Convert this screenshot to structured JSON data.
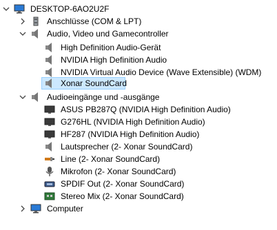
{
  "tree": {
    "root": {
      "label": "DESKTOP-6AO2U2F"
    },
    "ports": {
      "label": "Anschlüsse (COM & LPT)"
    },
    "audio_group": {
      "label": "Audio, Video und Gamecontroller",
      "items": [
        "High Definition Audio-Gerät",
        "NVIDIA High Definition Audio",
        "NVIDIA Virtual Audio Device (Wave Extensible) (WDM)",
        "Xonar SoundCard"
      ]
    },
    "io_group": {
      "label": "Audioeingänge und -ausgänge",
      "items": [
        "ASUS PB287Q (NVIDIA High Definition Audio)",
        "G276HL (NVIDIA High Definition Audio)",
        "HF287 (NVIDIA High Definition Audio)",
        "Lautsprecher (2- Xonar SoundCard)",
        "Line (2- Xonar SoundCard)",
        "Mikrofon (2- Xonar SoundCard)",
        "SPDIF Out (2- Xonar SoundCard)",
        "Stereo Mix (2- Xonar SoundCard)"
      ]
    },
    "computer": {
      "label": "Computer"
    }
  }
}
